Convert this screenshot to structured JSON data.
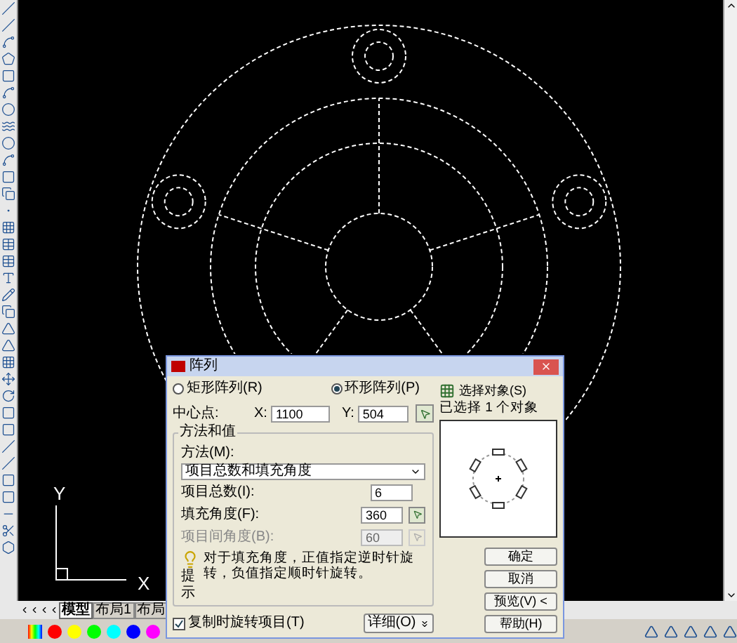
{
  "canvas": {
    "axis_labels": [
      "Y",
      "X"
    ]
  },
  "layout_tabs": [
    {
      "label": "模型",
      "selected": true
    },
    {
      "label": "布局1",
      "selected": false
    },
    {
      "label": "布局",
      "selected": false
    }
  ],
  "palette": [
    {
      "color": "#ff0000"
    },
    {
      "color": "#ffff00"
    },
    {
      "color": "#00ff00"
    },
    {
      "color": "#00ffff"
    },
    {
      "color": "#0000ff"
    },
    {
      "color": "#ff00ff"
    }
  ],
  "dialog": {
    "title": "阵列",
    "radios": [
      {
        "label": "矩形阵列(R)",
        "selected": false
      },
      {
        "label": "环形阵列(P)",
        "selected": true
      }
    ],
    "center_point": {
      "label": "中心点:",
      "x_label": "X:",
      "x_value": "1100",
      "y_label": "Y:",
      "y_value": "504"
    },
    "method_group": {
      "title": "方法和值",
      "method_label": "方法(M):",
      "method_value": "项目总数和填充角度",
      "fields": [
        {
          "label": "项目总数(I):",
          "value": "6",
          "disabled": false,
          "pick_button": false
        },
        {
          "label": "填充角度(F):",
          "value": "360",
          "disabled": false,
          "pick_button": true
        },
        {
          "label": "项目间角度(B):",
          "value": "60",
          "disabled": true,
          "pick_button": true
        }
      ],
      "tip": {
        "text": "对于填充角度，正值指定逆时针旋转，负值指定顺时针旋转。",
        "label": "提示"
      }
    },
    "rotate_checkbox": {
      "label": "复制时旋转项目(T)",
      "checked": true
    },
    "details_button": "详细(O)",
    "select_objects": "选择对象(S)",
    "selected_count": "已选择 1 个对象",
    "buttons": [
      "确定",
      "取消",
      "预览(V) <",
      "帮助(H)"
    ]
  }
}
